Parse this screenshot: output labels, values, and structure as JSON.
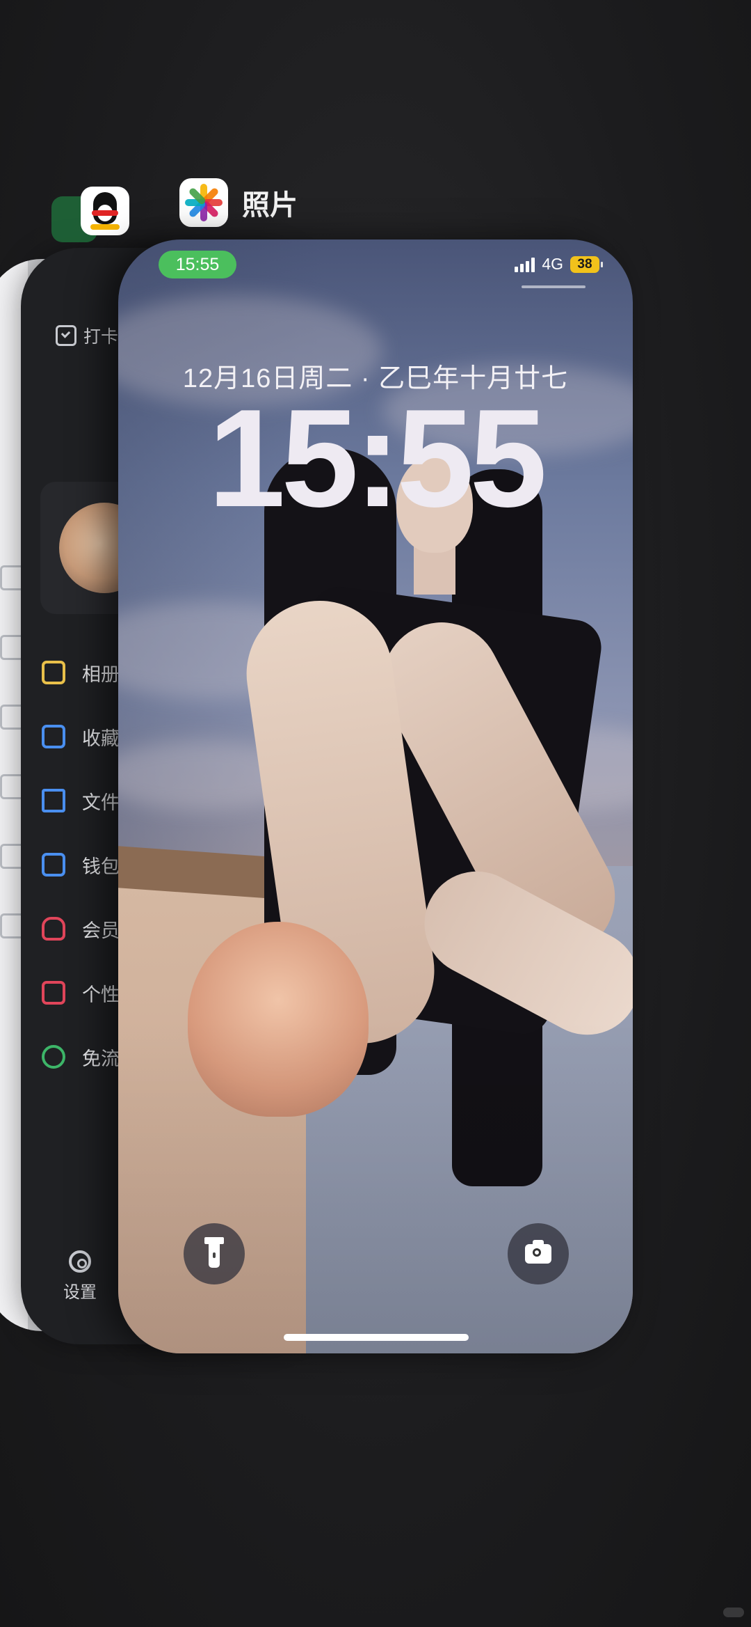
{
  "switcher": {
    "front_app_name": "照片"
  },
  "qq_card": {
    "checkin_label": "打卡",
    "menu_items": [
      {
        "label": "相册",
        "icon": "photo-album-icon",
        "color": "#e9c04a"
      },
      {
        "label": "收藏",
        "icon": "favorites-icon",
        "color": "#4a8ff0"
      },
      {
        "label": "文件",
        "icon": "folder-icon",
        "color": "#4a8ff0"
      },
      {
        "label": "钱包",
        "icon": "wallet-icon",
        "color": "#4a8ff0"
      },
      {
        "label": "会员",
        "icon": "vip-icon",
        "color": "#e0455a"
      },
      {
        "label": "个性",
        "icon": "personalize-icon",
        "color": "#e0455a"
      },
      {
        "label": "免流",
        "icon": "free-data-icon",
        "color": "#3db568"
      }
    ],
    "settings_label": "设置"
  },
  "lockscreen": {
    "status_time": "15:55",
    "network": "4G",
    "battery": "38",
    "date": "12月16日周二 · 乙巳年十月廿七",
    "time": "15:55"
  },
  "colors": {
    "status_pill": "#4bbf5d",
    "battery": "#f1c21b"
  }
}
